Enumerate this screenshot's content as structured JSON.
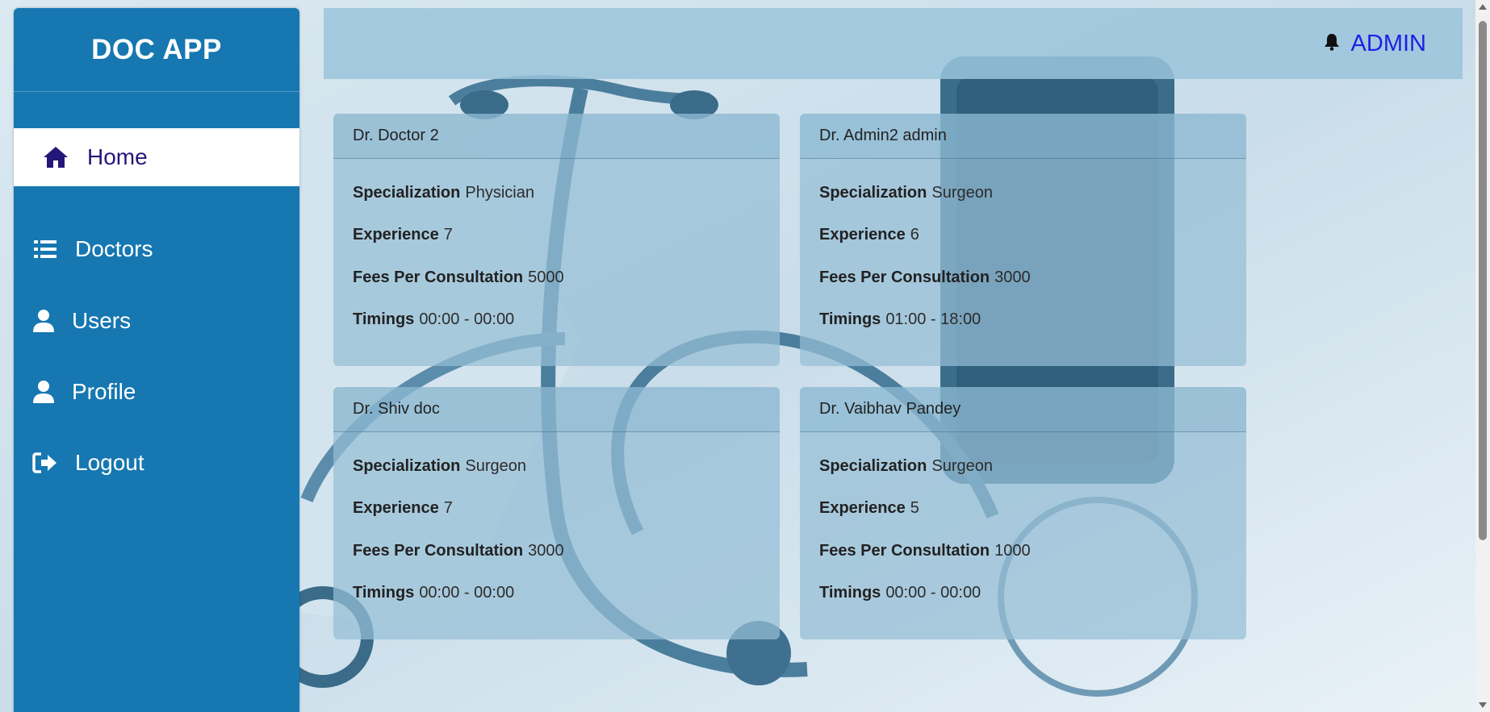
{
  "app": {
    "brand": "DOC APP"
  },
  "sidebar": {
    "items": [
      {
        "label": "Home",
        "icon": "home-icon",
        "active": true
      },
      {
        "label": "Doctors",
        "icon": "list-icon",
        "active": false
      },
      {
        "label": "Users",
        "icon": "user-icon",
        "active": false
      },
      {
        "label": "Profile",
        "icon": "user-icon",
        "active": false
      },
      {
        "label": "Logout",
        "icon": "logout-icon",
        "active": false
      }
    ]
  },
  "header": {
    "user_label": "ADMIN",
    "notification_icon": "bell-icon"
  },
  "labels": {
    "specialization": "Specialization",
    "experience": "Experience",
    "fees": "Fees Per Consultation",
    "timings": "Timings"
  },
  "doctors": [
    {
      "name": "Dr. Doctor 2",
      "specialization": "Physician",
      "experience": "7",
      "fees": "5000",
      "timings": "00:00 - 00:00"
    },
    {
      "name": "Dr. Admin2 admin",
      "specialization": "Surgeon",
      "experience": "6",
      "fees": "3000",
      "timings": "01:00 - 18:00"
    },
    {
      "name": "Dr. Shiv doc",
      "specialization": "Surgeon",
      "experience": "7",
      "fees": "3000",
      "timings": "00:00 - 00:00"
    },
    {
      "name": "Dr. Vaibhav Pandey",
      "specialization": "Surgeon",
      "experience": "5",
      "fees": "1000",
      "timings": "00:00 - 00:00"
    }
  ],
  "colors": {
    "sidebar": "#1677b1",
    "active_text": "#25167a",
    "admin_link": "#1f1fe6",
    "header_bg": "#9ac4db"
  }
}
